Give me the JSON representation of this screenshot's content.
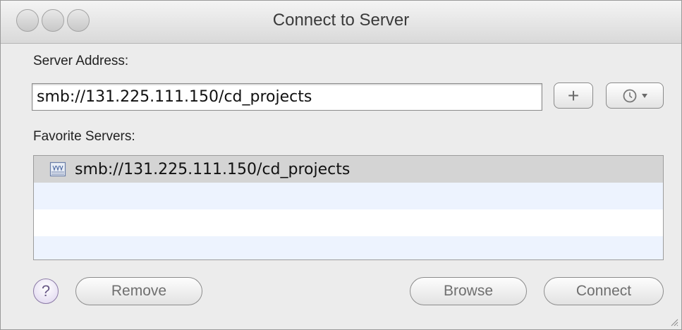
{
  "window": {
    "title": "Connect to Server"
  },
  "server_address": {
    "label": "Server Address:",
    "value": "smb://131.225.111.150/cd_projects"
  },
  "toolbar": {
    "add_label": "+",
    "recent_icon": "clock-icon"
  },
  "favorites": {
    "label": "Favorite Servers:",
    "items": [
      {
        "label": "smb://131.225.111.150/cd_projects",
        "icon": "network-server-icon",
        "selected": true
      }
    ]
  },
  "buttons": {
    "help_label": "?",
    "remove_label": "Remove",
    "browse_label": "Browse",
    "connect_label": "Connect"
  }
}
